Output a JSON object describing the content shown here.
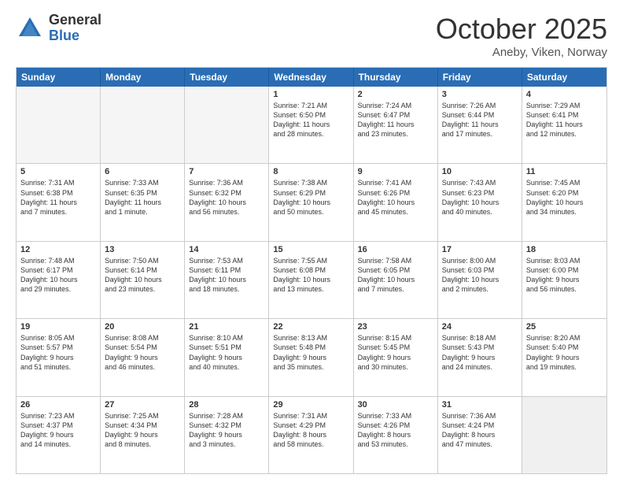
{
  "logo": {
    "general": "General",
    "blue": "Blue"
  },
  "title": {
    "month": "October 2025",
    "location": "Aneby, Viken, Norway"
  },
  "days": [
    "Sunday",
    "Monday",
    "Tuesday",
    "Wednesday",
    "Thursday",
    "Friday",
    "Saturday"
  ],
  "rows": [
    [
      {
        "num": "",
        "lines": [],
        "empty": true
      },
      {
        "num": "",
        "lines": [],
        "empty": true
      },
      {
        "num": "",
        "lines": [],
        "empty": true
      },
      {
        "num": "1",
        "lines": [
          "Sunrise: 7:21 AM",
          "Sunset: 6:50 PM",
          "Daylight: 11 hours",
          "and 28 minutes."
        ]
      },
      {
        "num": "2",
        "lines": [
          "Sunrise: 7:24 AM",
          "Sunset: 6:47 PM",
          "Daylight: 11 hours",
          "and 23 minutes."
        ]
      },
      {
        "num": "3",
        "lines": [
          "Sunrise: 7:26 AM",
          "Sunset: 6:44 PM",
          "Daylight: 11 hours",
          "and 17 minutes."
        ]
      },
      {
        "num": "4",
        "lines": [
          "Sunrise: 7:29 AM",
          "Sunset: 6:41 PM",
          "Daylight: 11 hours",
          "and 12 minutes."
        ]
      }
    ],
    [
      {
        "num": "5",
        "lines": [
          "Sunrise: 7:31 AM",
          "Sunset: 6:38 PM",
          "Daylight: 11 hours",
          "and 7 minutes."
        ]
      },
      {
        "num": "6",
        "lines": [
          "Sunrise: 7:33 AM",
          "Sunset: 6:35 PM",
          "Daylight: 11 hours",
          "and 1 minute."
        ]
      },
      {
        "num": "7",
        "lines": [
          "Sunrise: 7:36 AM",
          "Sunset: 6:32 PM",
          "Daylight: 10 hours",
          "and 56 minutes."
        ]
      },
      {
        "num": "8",
        "lines": [
          "Sunrise: 7:38 AM",
          "Sunset: 6:29 PM",
          "Daylight: 10 hours",
          "and 50 minutes."
        ]
      },
      {
        "num": "9",
        "lines": [
          "Sunrise: 7:41 AM",
          "Sunset: 6:26 PM",
          "Daylight: 10 hours",
          "and 45 minutes."
        ]
      },
      {
        "num": "10",
        "lines": [
          "Sunrise: 7:43 AM",
          "Sunset: 6:23 PM",
          "Daylight: 10 hours",
          "and 40 minutes."
        ]
      },
      {
        "num": "11",
        "lines": [
          "Sunrise: 7:45 AM",
          "Sunset: 6:20 PM",
          "Daylight: 10 hours",
          "and 34 minutes."
        ]
      }
    ],
    [
      {
        "num": "12",
        "lines": [
          "Sunrise: 7:48 AM",
          "Sunset: 6:17 PM",
          "Daylight: 10 hours",
          "and 29 minutes."
        ]
      },
      {
        "num": "13",
        "lines": [
          "Sunrise: 7:50 AM",
          "Sunset: 6:14 PM",
          "Daylight: 10 hours",
          "and 23 minutes."
        ]
      },
      {
        "num": "14",
        "lines": [
          "Sunrise: 7:53 AM",
          "Sunset: 6:11 PM",
          "Daylight: 10 hours",
          "and 18 minutes."
        ]
      },
      {
        "num": "15",
        "lines": [
          "Sunrise: 7:55 AM",
          "Sunset: 6:08 PM",
          "Daylight: 10 hours",
          "and 13 minutes."
        ]
      },
      {
        "num": "16",
        "lines": [
          "Sunrise: 7:58 AM",
          "Sunset: 6:05 PM",
          "Daylight: 10 hours",
          "and 7 minutes."
        ]
      },
      {
        "num": "17",
        "lines": [
          "Sunrise: 8:00 AM",
          "Sunset: 6:03 PM",
          "Daylight: 10 hours",
          "and 2 minutes."
        ]
      },
      {
        "num": "18",
        "lines": [
          "Sunrise: 8:03 AM",
          "Sunset: 6:00 PM",
          "Daylight: 9 hours",
          "and 56 minutes."
        ]
      }
    ],
    [
      {
        "num": "19",
        "lines": [
          "Sunrise: 8:05 AM",
          "Sunset: 5:57 PM",
          "Daylight: 9 hours",
          "and 51 minutes."
        ]
      },
      {
        "num": "20",
        "lines": [
          "Sunrise: 8:08 AM",
          "Sunset: 5:54 PM",
          "Daylight: 9 hours",
          "and 46 minutes."
        ]
      },
      {
        "num": "21",
        "lines": [
          "Sunrise: 8:10 AM",
          "Sunset: 5:51 PM",
          "Daylight: 9 hours",
          "and 40 minutes."
        ]
      },
      {
        "num": "22",
        "lines": [
          "Sunrise: 8:13 AM",
          "Sunset: 5:48 PM",
          "Daylight: 9 hours",
          "and 35 minutes."
        ]
      },
      {
        "num": "23",
        "lines": [
          "Sunrise: 8:15 AM",
          "Sunset: 5:45 PM",
          "Daylight: 9 hours",
          "and 30 minutes."
        ]
      },
      {
        "num": "24",
        "lines": [
          "Sunrise: 8:18 AM",
          "Sunset: 5:43 PM",
          "Daylight: 9 hours",
          "and 24 minutes."
        ]
      },
      {
        "num": "25",
        "lines": [
          "Sunrise: 8:20 AM",
          "Sunset: 5:40 PM",
          "Daylight: 9 hours",
          "and 19 minutes."
        ]
      }
    ],
    [
      {
        "num": "26",
        "lines": [
          "Sunrise: 7:23 AM",
          "Sunset: 4:37 PM",
          "Daylight: 9 hours",
          "and 14 minutes."
        ]
      },
      {
        "num": "27",
        "lines": [
          "Sunrise: 7:25 AM",
          "Sunset: 4:34 PM",
          "Daylight: 9 hours",
          "and 8 minutes."
        ]
      },
      {
        "num": "28",
        "lines": [
          "Sunrise: 7:28 AM",
          "Sunset: 4:32 PM",
          "Daylight: 9 hours",
          "and 3 minutes."
        ]
      },
      {
        "num": "29",
        "lines": [
          "Sunrise: 7:31 AM",
          "Sunset: 4:29 PM",
          "Daylight: 8 hours",
          "and 58 minutes."
        ]
      },
      {
        "num": "30",
        "lines": [
          "Sunrise: 7:33 AM",
          "Sunset: 4:26 PM",
          "Daylight: 8 hours",
          "and 53 minutes."
        ]
      },
      {
        "num": "31",
        "lines": [
          "Sunrise: 7:36 AM",
          "Sunset: 4:24 PM",
          "Daylight: 8 hours",
          "and 47 minutes."
        ]
      },
      {
        "num": "",
        "lines": [],
        "empty": true,
        "shaded": true
      }
    ]
  ]
}
